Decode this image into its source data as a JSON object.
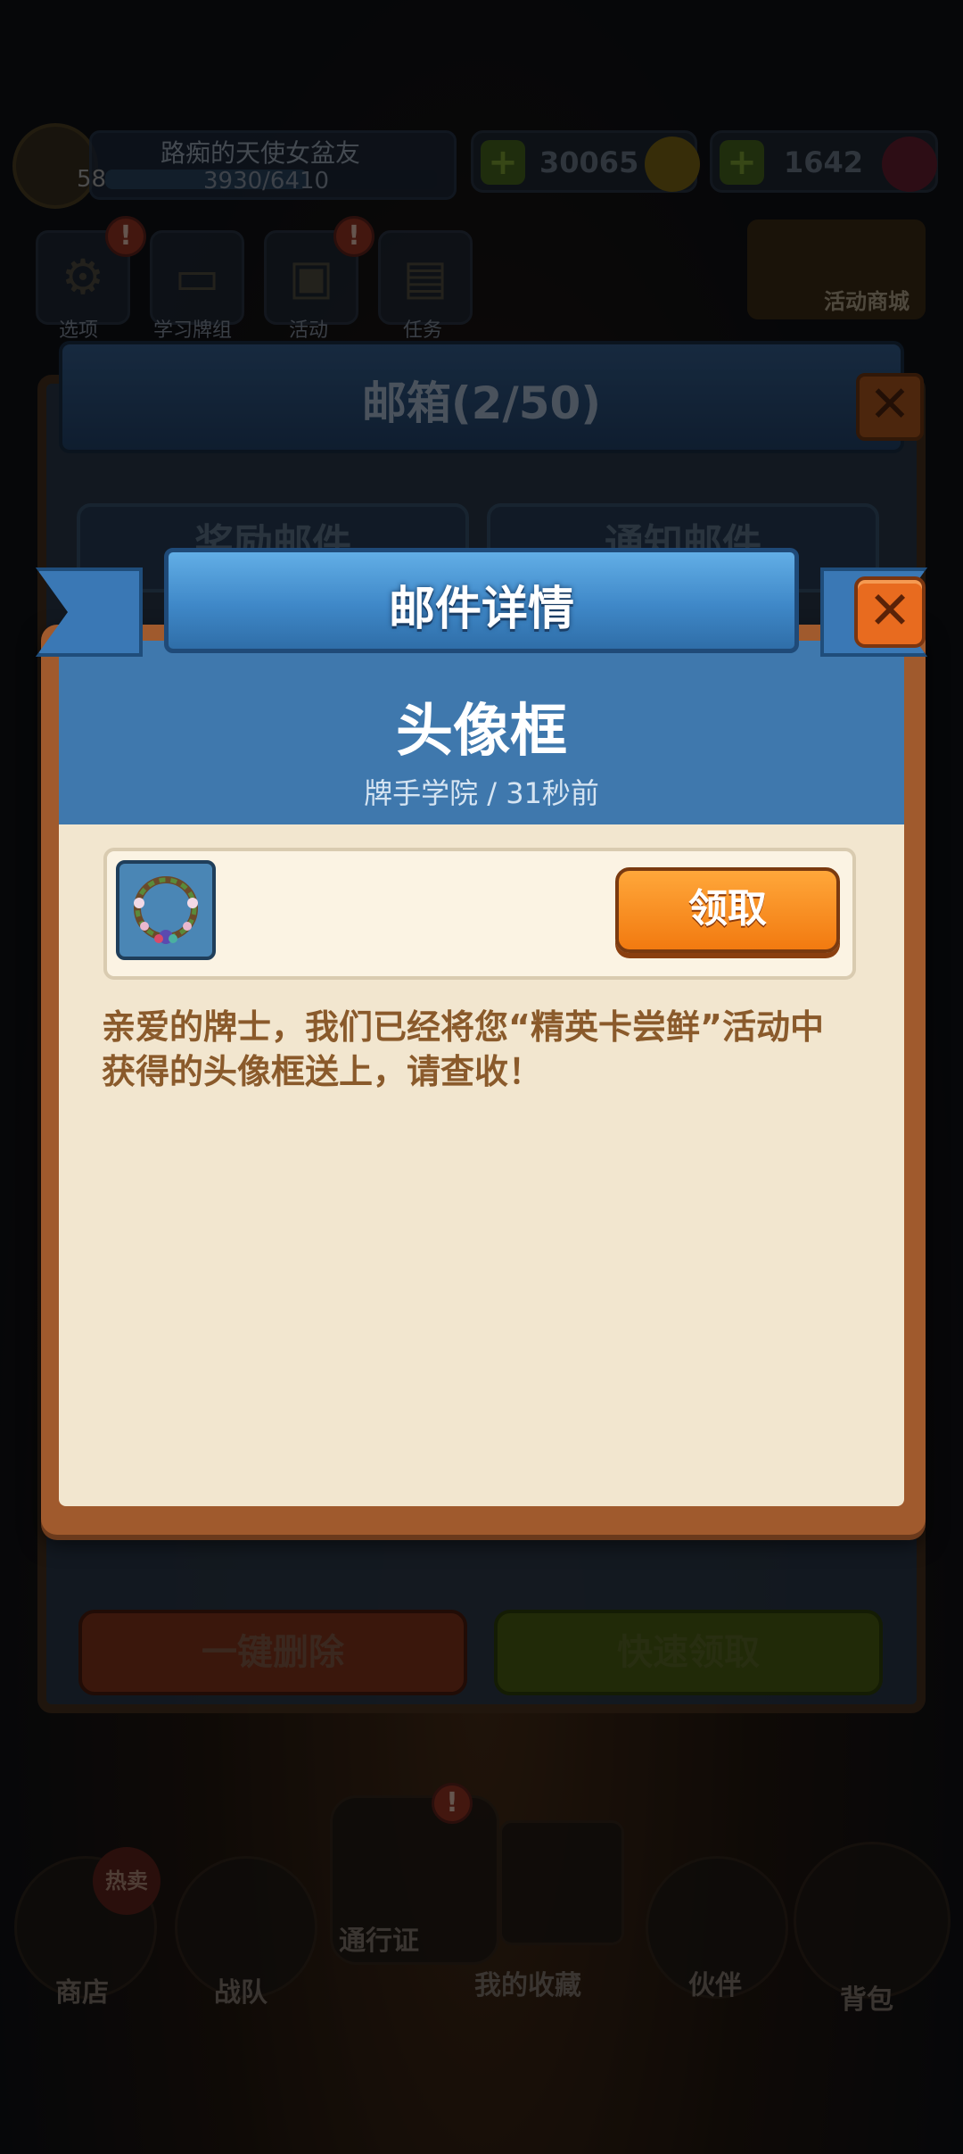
{
  "top_bar": {
    "player_name": "路痴的天使女盆友",
    "level": "58",
    "exp_text": "3930/6410",
    "exp_fraction": 0.613,
    "gold": "30065",
    "gems": "1642"
  },
  "menu": [
    {
      "label": "选项",
      "icon": "gear-icon",
      "badge": "!"
    },
    {
      "label": "学习牌组",
      "icon": "tv-icon",
      "badge": ""
    },
    {
      "label": "活动",
      "icon": "gift-icon",
      "badge": "!"
    },
    {
      "label": "任务",
      "icon": "scroll-icon",
      "badge": ""
    }
  ],
  "activity_mall": "活动商城",
  "mailbox": {
    "title": "邮箱(2/50)",
    "tabs": [
      "奖励邮件",
      "通知邮件"
    ],
    "delete_all": "一键删除",
    "quick_claim": "快速领取",
    "close_icon": "close-icon"
  },
  "detail": {
    "ribbon_title": "邮件详情",
    "mail_title": "头像框",
    "meta": "牌手学院 / 31秒前",
    "item_icon": "wreath-avatar-frame-icon",
    "claim_label": "领取",
    "body": "亲爱的牌士，我们已经将您“精英卡尝鲜”活动中获得的头像框送上，请查收！",
    "colors": {
      "header_blue": "#3f78ad",
      "parchment": "#f2e6cf",
      "claim_orange": "#f27a10",
      "close_orange": "#e86b1f",
      "body_brown": "#8a5a2b"
    }
  },
  "bottom_nav": [
    {
      "label": "商店",
      "badge": "热卖"
    },
    {
      "label": "战队"
    },
    {
      "label": "通行证",
      "badge": "!"
    },
    {
      "label": "我的收藏"
    },
    {
      "label": "伙伴"
    },
    {
      "label": "背包"
    }
  ]
}
